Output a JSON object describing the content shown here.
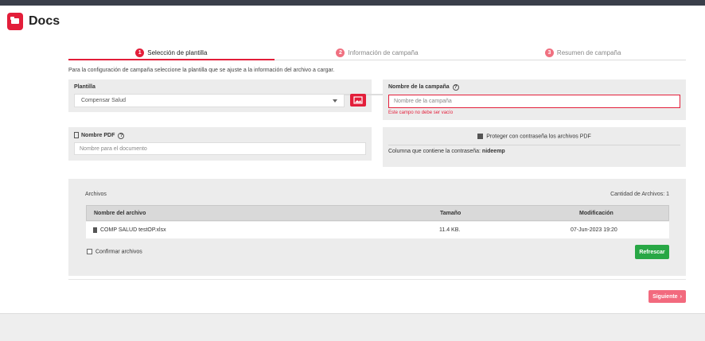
{
  "app": {
    "title": "Docs"
  },
  "steps": [
    {
      "num": "1",
      "label": "Selección de plantilla"
    },
    {
      "num": "2",
      "label": "Información de campaña"
    },
    {
      "num": "3",
      "label": "Resumen de campaña"
    }
  ],
  "intro": "Para la configuración de campaña seleccione la plantilla que se ajuste a la información del archivo a cargar.",
  "template": {
    "label": "Plantilla",
    "selected": "Compensar Salud"
  },
  "campaign": {
    "label": "Nombre de la campaña",
    "placeholder": "Nombre de la campaña",
    "error": "Este campo no debe ser vacío"
  },
  "pdf": {
    "label": "Nombre PDF",
    "placeholder": "Nombre para el documento"
  },
  "protect": {
    "checkbox_label": "Proteger con contraseña los archivos PDF",
    "column_label": "Columna que contiene la contraseña:",
    "column_value": "nideemp"
  },
  "files": {
    "title": "Archivos",
    "count_label": "Cantidad de Archivos: 1",
    "columns": [
      "Nombre del archivo",
      "Tamaño",
      "Modificación"
    ],
    "rows": [
      {
        "name": "COMP SALUD testOP.xlsx",
        "size": "11.4 KB.",
        "modified": "07-Jun-2023 19:20"
      }
    ],
    "confirm_label": "Confirmar archivos",
    "refresh_label": "Refrescar"
  },
  "next_label": "Siguiente",
  "colors": {
    "accent": "#e31e3a",
    "success": "#28a745"
  }
}
